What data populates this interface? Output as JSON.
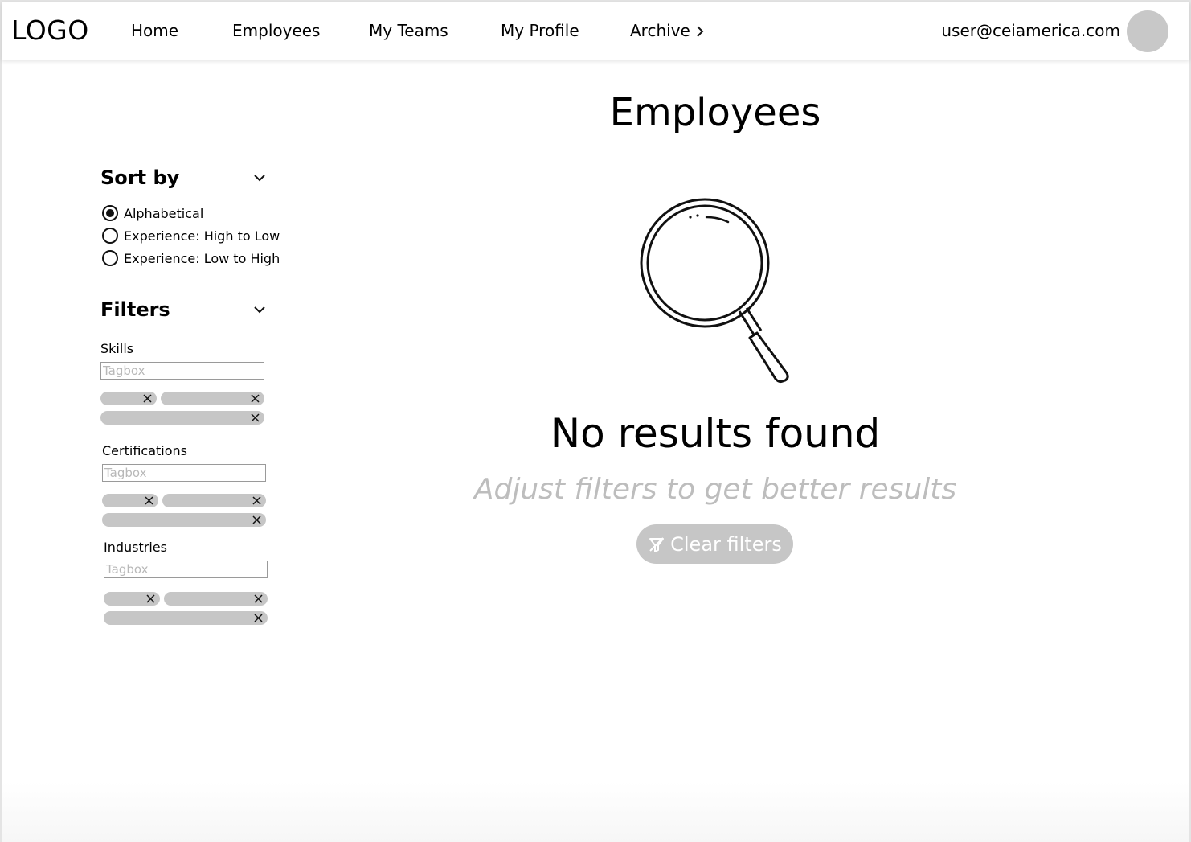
{
  "header": {
    "logo": "LOGO",
    "nav": [
      {
        "label": "Home"
      },
      {
        "label": "Employees"
      },
      {
        "label": "My Teams"
      },
      {
        "label": "My Profile"
      },
      {
        "label": "Archive"
      }
    ],
    "user_email": "user@ceiamerica.com"
  },
  "main": {
    "title": "Employees",
    "empty_state": {
      "icon": "magnifying-glass-icon",
      "title": "No results found",
      "subtitle": "Adjust filters to get better results",
      "button_label": "Clear filters",
      "button_icon": "filter-off-icon"
    }
  },
  "sidebar": {
    "sort": {
      "heading": "Sort by",
      "options": [
        {
          "label": "Alphabetical",
          "selected": true
        },
        {
          "label": "Experience: High to Low",
          "selected": false
        },
        {
          "label": "Experience: Low to High",
          "selected": false
        }
      ]
    },
    "filters": {
      "heading": "Filters",
      "groups": [
        {
          "label": "Skills",
          "placeholder": "Tagbox"
        },
        {
          "label": "Certifications",
          "placeholder": "Tagbox"
        },
        {
          "label": "Industries",
          "placeholder": "Tagbox"
        }
      ]
    }
  },
  "colors": {
    "chip": "#c6c6c6",
    "button": "#c6c6c6",
    "avatar": "#c8c8c8",
    "muted_text": "#bdbdbd"
  }
}
